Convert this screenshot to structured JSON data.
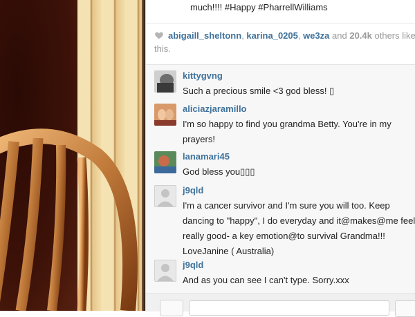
{
  "post": {
    "caption": "much!!!! #Happy #PharrellWilliams"
  },
  "likes": {
    "users": [
      "abigaill_sheltonn",
      "karina_0205",
      "we3za"
    ],
    "sep1": ", ",
    "sep2": ", ",
    "and_text": " and ",
    "count": "20.4k",
    "suffix": " others like this."
  },
  "comments": [
    {
      "username": "kittygvng",
      "text": "Such a precious smile <3 god bless! ▯"
    },
    {
      "username": "aliciazjaramillo",
      "text": "I'm so happy to find you grandma Betty. You're in my prayers!"
    },
    {
      "username": "lanamari45",
      "text": "God bless you▯▯▯"
    },
    {
      "username": "j9qld",
      "text": "I'm a cancer survivor and I'm sure you will too. Keep dancing to \"happy\", I do everyday and it@makes@me feel really good- a key emotion@to survival Grandma!!! LoveJanine ( Australia)"
    },
    {
      "username": "j9qld",
      "text": "And as you can see I can't type. Sorry.xxx"
    }
  ]
}
